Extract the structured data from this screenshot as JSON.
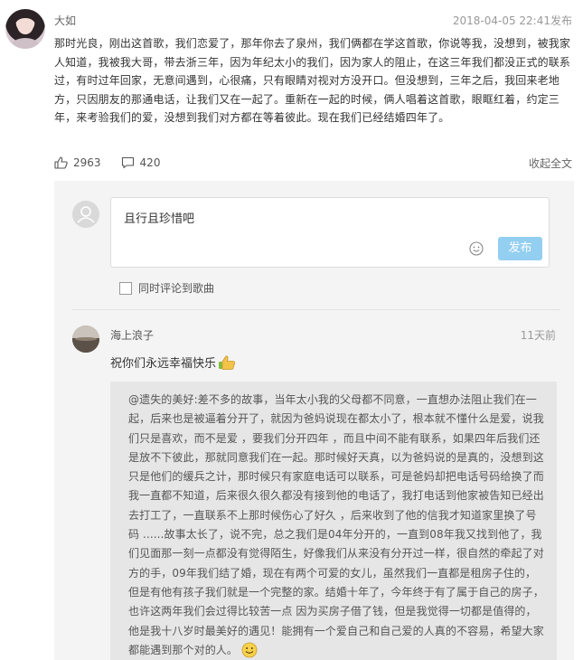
{
  "post": {
    "author": "大如",
    "timestamp": "2018-04-05 22:41发布",
    "content": "那时光良，刚出这首歌，我们恋爱了，那年你去了泉州，我们俩都在学这首歌，你说等我，没想到，被我家人知道，我被我大哥，带去浙三年，因为年纪太小的我们，因为家人的阻止，在这三年我们都没正式的联系过，有时过年回家，无意间遇到，心很痛，只有眼睛对视对方没开口。但没想到，三年之后，我回来老地方，只因朋友的那通电话，让我们又在一起了。重新在一起的时候，俩人唱着这首歌，眼眶红着，约定三年，来考验我们的爱，没想到我们对方都在等着彼此。现在我们已经结婚四年了。",
    "likes": "2963",
    "comments": "420",
    "collapse_label": "收起全文"
  },
  "reply_form": {
    "input_value": "且行且珍惜吧",
    "publish_label": "发布",
    "sync_label": "同时评论到歌曲"
  },
  "comment": {
    "author": "海上浪子",
    "time": "11天前",
    "text": "祝你们永远幸福快乐",
    "quoted": "@遗失的美好:差不多的故事，当年太小我的父母都不同意，一直想办法阻止我们在一起，后来也是被逼着分开了，就因为爸妈说现在都太小了，根本就不懂什么是爱，说我们只是喜欢，而不是爱 ，要我们分开四年 ，而且中间不能有联系，如果四年后我们还是放不下彼此，那就同意我们在一起。那时候好天真，以为爸妈说的是真的，没想到这只是他们的缓兵之计，那时候只有家庭电话可以联系，可是爸妈却把电话号码给换了而我一直都不知道，后来很久很久都没有接到他的电话了，我打电话到他家被告知已经出去打工了，一直联系不上那时候伤心了好久 ，后来收到了他的信我才知道家里换了号码 ......故事太长了，说不完，总之我们是04年分开的，一直到08年我又找到他了，我们见面那一刻一点都没有觉得陌生，好像我们从来没有分开过一样，很自然的牵起了对方的手，09年我们结了婚，现在有两个可爱的女儿，虽然我们一直都是租房子住的，但是有他有孩子我们就是一个完整的家。结婚十年了，今年终于有了属于自己的房子，也许这两年我们会过得比较苦一点 因为买房子借了钱，但是我觉得一切都是值得的，他是我十八岁时最美好的遇见！能拥有一个爱自己和自己爱的人真的不容易，希望大家都能遇到那个对的人。"
  },
  "icons": {
    "like": "thumbs-up-icon",
    "comment": "speech-bubble-icon",
    "emoji": "smiley-icon",
    "thumbs": "thumbs-up-emoji-icon",
    "smile": "smile-emoji-icon"
  },
  "colors": {
    "publish_button": "#93cff0",
    "panel_bg": "#f4f4f4",
    "quote_bg": "#e6e6e6"
  }
}
